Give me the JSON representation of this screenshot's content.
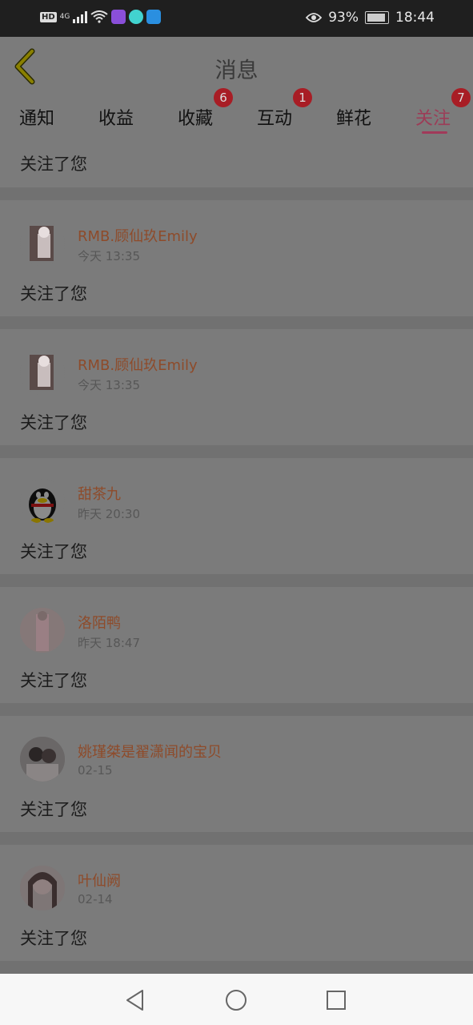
{
  "status_bar": {
    "hd": "HD",
    "network": "4G",
    "battery": "93%",
    "time": "18:44",
    "icons": [
      "hd-icon",
      "signal-icon",
      "wifi-icon",
      "video-app-icon",
      "chat-app-icon",
      "hotspot-app-icon",
      "eye-icon",
      "battery-icon"
    ]
  },
  "header": {
    "title": "消息",
    "back_icon": "chevron-left-icon"
  },
  "tabs": [
    {
      "label": "通知"
    },
    {
      "label": "收益"
    },
    {
      "label": "收藏",
      "badge": "6"
    },
    {
      "label": "互动",
      "badge": "1"
    },
    {
      "label": "鲜花"
    },
    {
      "label": "关注",
      "badge": "7",
      "active": true
    }
  ],
  "top_partial": {
    "message": "关注了您"
  },
  "items": [
    {
      "name": "RMB.顾仙玖Emily",
      "time": "今天 13:35",
      "message": "关注了您",
      "avatar": "anime-girl-avatar"
    },
    {
      "name": "RMB.顾仙玖Emily",
      "time": "今天 13:35",
      "message": "关注了您",
      "avatar": "anime-girl-avatar"
    },
    {
      "name": "甜茶九",
      "time": "昨天 20:30",
      "message": "关注了您",
      "avatar": "penguin-avatar"
    },
    {
      "name": "洛陌鸭",
      "time": "昨天 18:47",
      "message": "关注了您",
      "avatar": "photo-avatar"
    },
    {
      "name": "姚瑾桀是翟潇闻的宝贝",
      "time": "02-15",
      "message": "关注了您",
      "avatar": "photo-avatar"
    },
    {
      "name": "叶仙阙",
      "time": "02-14",
      "message": "关注了您",
      "avatar": "photo-avatar"
    }
  ],
  "nav": {
    "icons": [
      "back-triangle-icon",
      "home-circle-icon",
      "recents-square-icon"
    ]
  },
  "colors": {
    "accent": "#a13a5a",
    "badge": "#a81d25",
    "name": "#8e4b2a"
  }
}
